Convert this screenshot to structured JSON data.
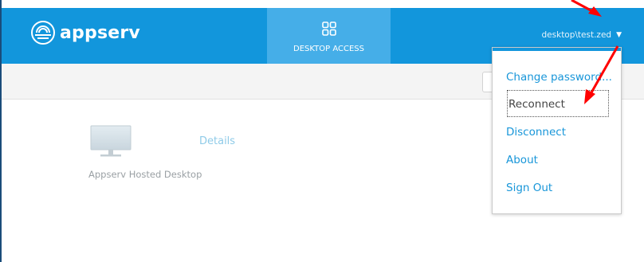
{
  "header": {
    "brand": "appserv",
    "tab_desktop_label": "DESKTOP ACCESS",
    "user_label": "desktop\\test.zed",
    "accent_color": "#1296dc"
  },
  "desktop_item": {
    "name": "Appserv Hosted Desktop",
    "details_label": "Details"
  },
  "user_menu": {
    "items": [
      "Change password...",
      "Reconnect",
      "Disconnect",
      "About",
      "Sign Out"
    ]
  },
  "icons": {
    "brand": "appserv-logo-icon",
    "tab": "grid-icon",
    "caret": "caret-down-icon",
    "monitor": "monitor-icon"
  },
  "annotation_color": "#ff0000"
}
